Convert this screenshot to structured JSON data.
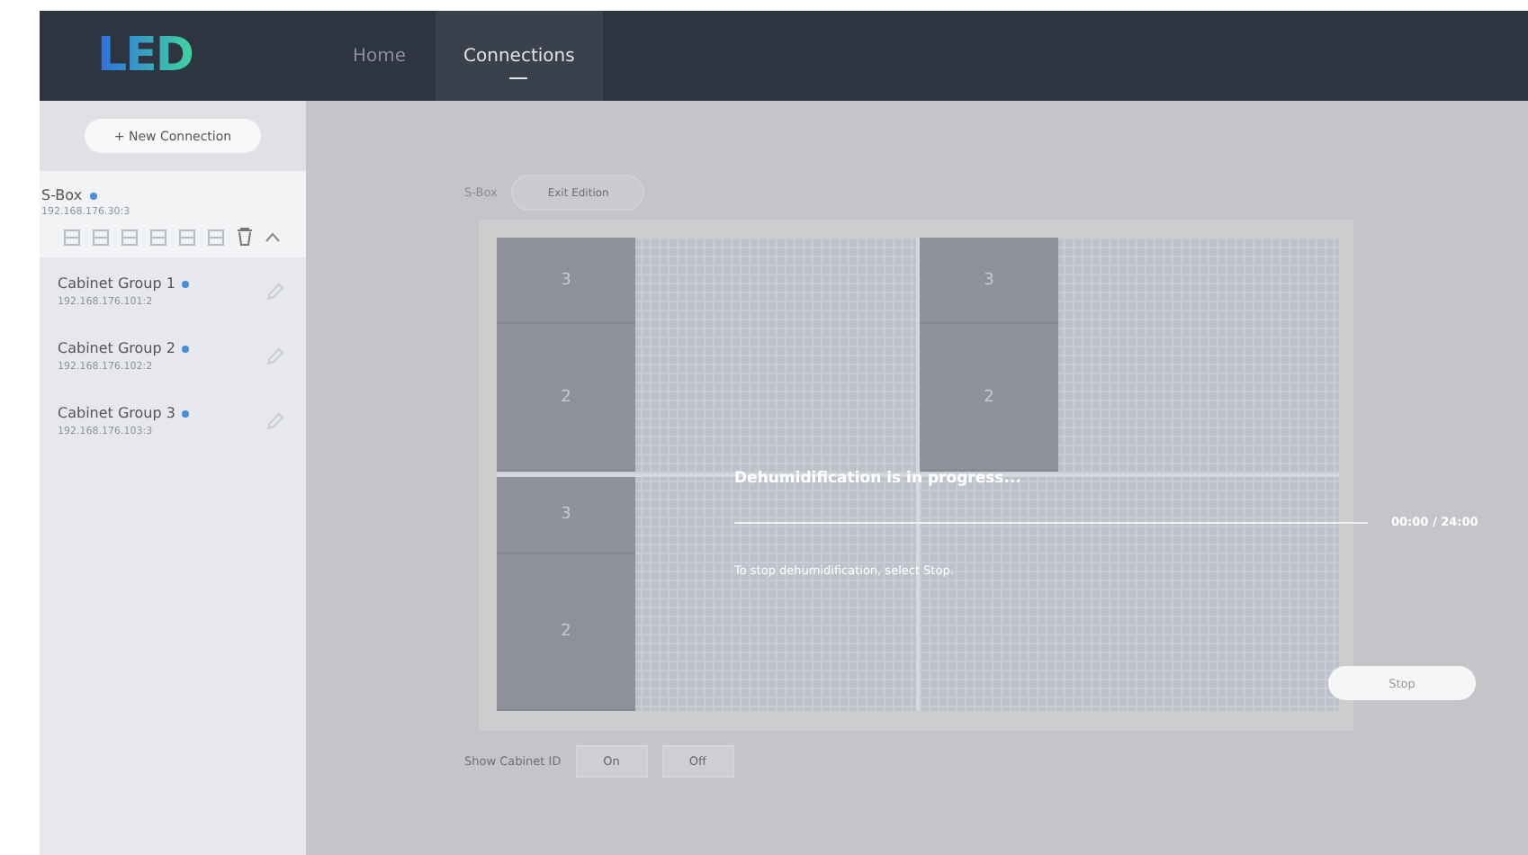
{
  "nav": {
    "logo": "LED",
    "tabs": [
      {
        "label": "Home",
        "selected": false
      },
      {
        "label": "Connections",
        "selected": true
      }
    ]
  },
  "sidebar": {
    "new_button": "+  New Connection",
    "device": {
      "name": "S-Box",
      "address": "192.168.176.30:3",
      "color": "#4a8fd8"
    },
    "groups": [
      {
        "name": "Cabinet Group 1",
        "address": "192.168.176.101:2",
        "color": "#4a8fd8"
      },
      {
        "name": "Cabinet Group 2",
        "address": "192.168.176.102:2",
        "color": "#4a8fd8"
      },
      {
        "name": "Cabinet Group 3",
        "address": "192.168.176.103:3",
        "color": "#4a8fd8"
      }
    ]
  },
  "editor": {
    "device_label": "S-Box",
    "edit_button": "Exit Edition",
    "cabinets": [
      {
        "label": "3"
      },
      {
        "label": "3"
      },
      {
        "label": "2"
      },
      {
        "label": "2"
      },
      {
        "label": "3"
      },
      {
        "label": "2"
      }
    ],
    "show_id_label": "Show Cabinet ID",
    "show_id_options": [
      {
        "label": "On",
        "selected": false
      },
      {
        "label": "Off",
        "selected": false
      }
    ]
  },
  "dialog": {
    "title": "Dehumidification is in progress...",
    "level": 0,
    "time": "00:00 / 24:00",
    "message": "To stop dehumidification, select Stop.",
    "button": "Stop"
  }
}
